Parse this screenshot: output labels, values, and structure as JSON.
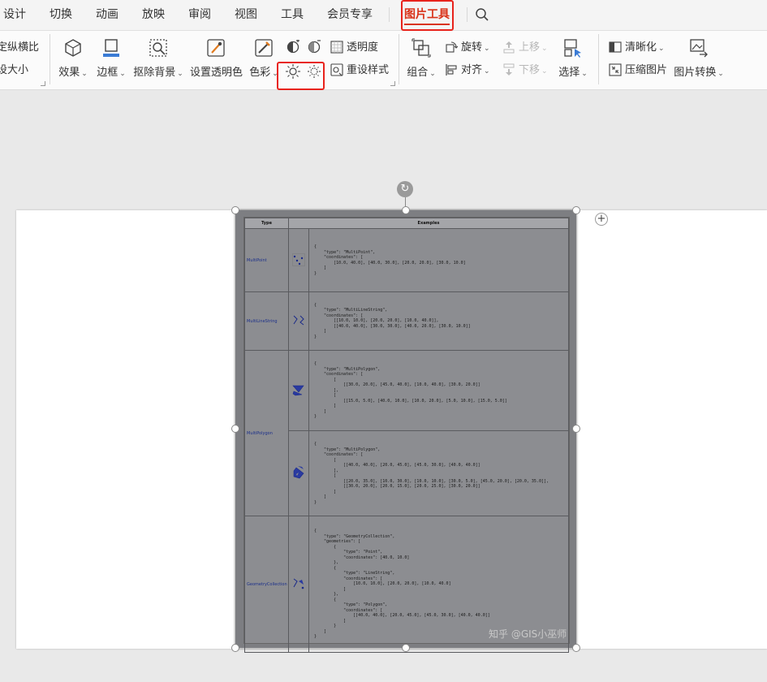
{
  "menu": {
    "items": [
      "设计",
      "切换",
      "动画",
      "放映",
      "审阅",
      "视图",
      "工具",
      "会员专享"
    ],
    "active_tab": "图片工具"
  },
  "ribbon": {
    "left_partial_1": "定纵横比",
    "left_partial_2": "设大小",
    "effects": "效果",
    "border": "边框",
    "remove_bg": "抠除背景",
    "set_transparent_color": "设置透明色",
    "color": "色彩",
    "transparency": "透明度",
    "reset_style": "重设样式",
    "combine": "组合",
    "rotate": "旋转",
    "align": "对齐",
    "bring_forward": "上移",
    "send_backward": "下移",
    "select": "选择",
    "sharpen": "清晰化",
    "compress": "压缩图片",
    "convert": "图片转换"
  },
  "figure": {
    "header_type": "Type",
    "header_examples": "Examples",
    "rows": [
      {
        "type": "MultiPoint",
        "code": "{\n    \"type\": \"MultiPoint\",\n    \"coordinates\": [\n        [10.0, 40.0], [40.0, 30.0], [20.0, 20.0], [30.0, 10.0]\n    ]\n}"
      },
      {
        "type": "MultiLineString",
        "code": "{\n    \"type\": \"MultiLineString\",\n    \"coordinates\": [\n        [[10.0, 10.0], [20.0, 20.0], [10.0, 40.0]],\n        [[40.0, 40.0], [30.0, 30.0], [40.0, 20.0], [30.0, 10.0]]\n    ]\n}"
      },
      {
        "type": "MultiPolygon",
        "code": "{\n    \"type\": \"MultiPolygon\",\n    \"coordinates\": [\n        [\n            [[30.0, 20.0], [45.0, 40.0], [10.0, 40.0], [30.0, 20.0]]\n        ],\n        [\n            [[15.0, 5.0], [40.0, 10.0], [10.0, 20.0], [5.0, 10.0], [15.0, 5.0]]\n        ]\n    ]\n}"
      },
      {
        "type": "",
        "code": "{\n    \"type\": \"MultiPolygon\",\n    \"coordinates\": [\n        [\n            [[40.0, 40.0], [20.0, 45.0], [45.0, 30.0], [40.0, 40.0]]\n        ],\n        [\n            [[20.0, 35.0], [10.0, 30.0], [10.0, 10.0], [30.0, 5.0], [45.0, 20.0], [20.0, 35.0]],\n            [[30.0, 20.0], [20.0, 15.0], [20.0, 25.0], [30.0, 20.0]]\n        ]\n    ]\n}"
      },
      {
        "type": "GeometryCollection",
        "code": "{\n    \"type\": \"GeometryCollection\",\n    \"geometries\": [\n        {\n            \"type\": \"Point\",\n            \"coordinates\": [40.0, 10.0]\n        },\n        {\n            \"type\": \"LineString\",\n            \"coordinates\": [\n                [10.0, 10.0], [20.0, 20.0], [10.0, 40.0]\n            ]\n        },\n        {\n            \"type\": \"Polygon\",\n            \"coordinates\": [\n                [[40.0, 40.0], [20.0, 45.0], [45.0, 30.0], [40.0, 40.0]]\n            ]\n        }\n    ]\n}"
      }
    ]
  },
  "watermark": "知乎 @GIS小巫师",
  "colors": {
    "accent": "#d9331a",
    "highlight_box": "#e8231c",
    "picture_bg": "#8c8d91"
  }
}
